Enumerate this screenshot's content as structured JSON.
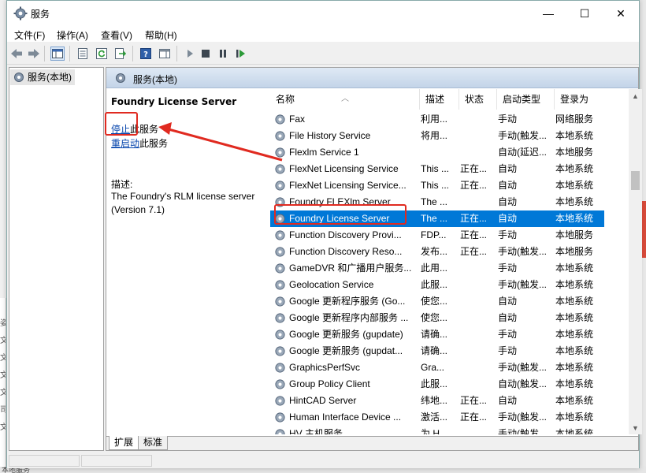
{
  "window": {
    "title": "服务",
    "minimize_glyph": "—",
    "maximize_glyph": "☐",
    "close_glyph": "✕"
  },
  "menu": [
    "文件(F)",
    "操作(A)",
    "查看(V)",
    "帮助(H)"
  ],
  "tree": {
    "root": "服务(本地)"
  },
  "pane": {
    "header": "服务(本地)",
    "selected_service": "Foundry License Server",
    "stop_link": "停止",
    "stop_suffix": "此服务",
    "restart_link": "重启动",
    "restart_suffix": "此服务",
    "desc_label": "描述:",
    "desc_text": "The Foundry's RLM license server (Version 7.1)"
  },
  "columns": [
    "名称",
    "描述",
    "状态",
    "启动类型",
    "登录为"
  ],
  "services": [
    [
      "Fax",
      "利用...",
      "",
      "手动",
      "网络服务"
    ],
    [
      "File History Service",
      "将用...",
      "",
      "手动(触发...",
      "本地系统"
    ],
    [
      "Flexlm Service 1",
      "",
      "",
      "自动(延迟...",
      "本地服务"
    ],
    [
      "FlexNet Licensing Service",
      "This ...",
      "正在...",
      "自动",
      "本地系统"
    ],
    [
      "FlexNet Licensing Service...",
      "This ...",
      "正在...",
      "自动",
      "本地系统"
    ],
    [
      "Foundry FLEXlm Server",
      "The ...",
      "",
      "自动",
      "本地系统"
    ],
    [
      "Foundry License Server",
      "The ...",
      "正在...",
      "自动",
      "本地系统"
    ],
    [
      "Function Discovery Provi...",
      "FDP...",
      "正在...",
      "手动",
      "本地服务"
    ],
    [
      "Function Discovery Reso...",
      "发布...",
      "正在...",
      "手动(触发...",
      "本地服务"
    ],
    [
      "GameDVR 和广播用户服务...",
      "此用...",
      "",
      "手动",
      "本地系统"
    ],
    [
      "Geolocation Service",
      "此服...",
      "",
      "手动(触发...",
      "本地系统"
    ],
    [
      "Google 更新程序服务 (Go...",
      "使您...",
      "",
      "自动",
      "本地系统"
    ],
    [
      "Google 更新程序内部服务 ...",
      "使您...",
      "",
      "自动",
      "本地系统"
    ],
    [
      "Google 更新服务 (gupdate)",
      "请确...",
      "",
      "手动",
      "本地系统"
    ],
    [
      "Google 更新服务 (gupdat...",
      "请确...",
      "",
      "手动",
      "本地系统"
    ],
    [
      "GraphicsPerfSvc",
      "Gra...",
      "",
      "手动(触发...",
      "本地系统"
    ],
    [
      "Group Policy Client",
      "此服...",
      "",
      "自动(触发...",
      "本地系统"
    ],
    [
      "HintCAD Server",
      "纬地...",
      "正在...",
      "自动",
      "本地系统"
    ],
    [
      "Human Interface Device ...",
      "激活...",
      "正在...",
      "手动(触发...",
      "本地系统"
    ],
    [
      "HV 主机服务",
      "为 H...",
      "",
      "手动(触发...",
      "本地系统"
    ]
  ],
  "selected_index": 6,
  "tabs": [
    "扩展",
    "标准"
  ],
  "background": {
    "left_fragments": [
      "",
      "姿",
      "文",
      "文",
      "文",
      "文",
      "司",
      "文"
    ],
    "bottom_fragment": "本地服务"
  },
  "colors": {
    "selection": "#0078d7",
    "highlight": "#e02a20",
    "link": "#0645ad"
  }
}
